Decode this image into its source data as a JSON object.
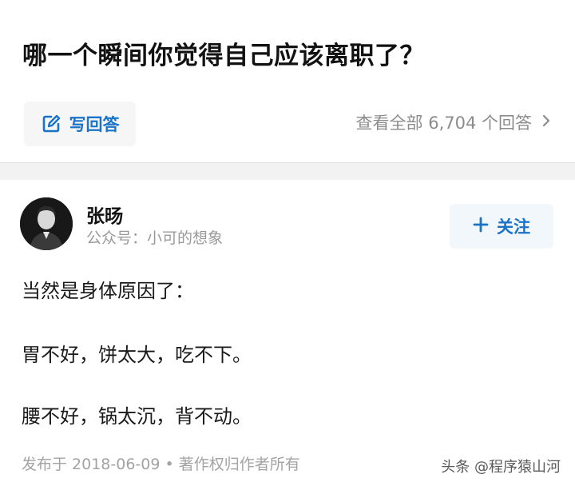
{
  "question": {
    "title": "哪一个瞬间你觉得自己应该离职了？",
    "write_answer_label": "写回答",
    "view_all_label": "查看全部 6,704 个回答"
  },
  "answer": {
    "author_name": "张旸",
    "author_subtitle": "公众号：小可的想象",
    "follow_label": "关注",
    "lines": [
      "当然是身体原因了：",
      "胃不好，饼太大，吃不下。",
      "腰不好，锅太沉，背不动。"
    ],
    "footer": "发布于 2018-06-09 • 著作权归作者所有"
  },
  "watermark": "头条 @程序猿山河",
  "colors": {
    "accent": "#1a73c8",
    "muted": "#8c8c8c"
  }
}
